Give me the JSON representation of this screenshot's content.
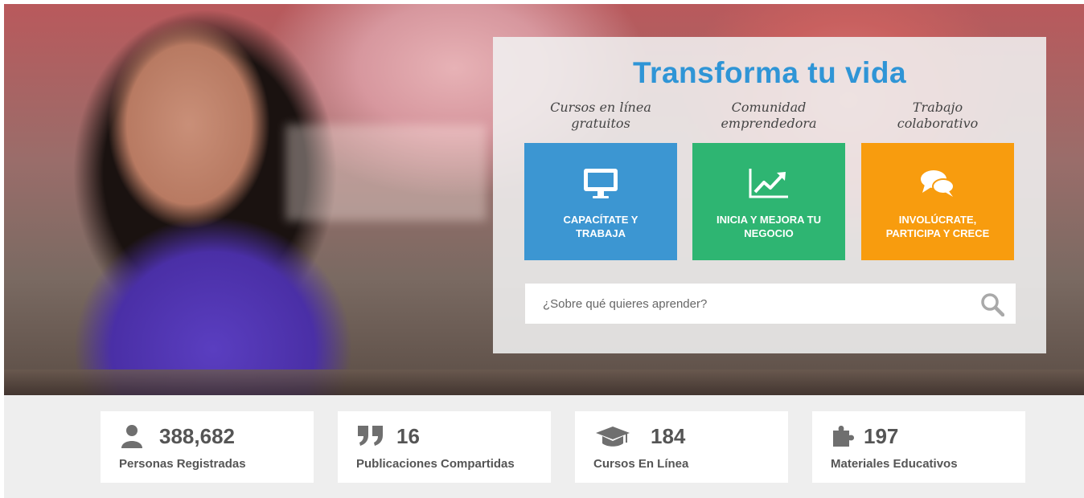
{
  "hero": {
    "title": "Transforma tu vida",
    "taglines": [
      {
        "line1": "Cursos en línea",
        "line2": "gratuitos"
      },
      {
        "line1": "Comunidad",
        "line2": "emprendedora"
      },
      {
        "line1": "Trabajo",
        "line2": "colaborativo"
      }
    ],
    "tiles": [
      {
        "line1": "CAPACÍTATE Y",
        "line2": "TRABAJA",
        "icon": "monitor-icon",
        "color": "#3c96d2"
      },
      {
        "line1": "INICIA Y MEJORA TU",
        "line2": "NEGOCIO",
        "icon": "chart-line-icon",
        "color": "#2eb572"
      },
      {
        "line1": "INVOLÚCRATE,",
        "line2": "PARTICIPA Y CRECE",
        "icon": "chat-bubbles-icon",
        "color": "#f89c0e"
      }
    ],
    "search": {
      "placeholder": "¿Sobre qué quieres aprender?",
      "icon": "search-icon"
    }
  },
  "stats": [
    {
      "value": "388,682",
      "label": "Personas Registradas",
      "icon": "user-icon"
    },
    {
      "value": "16",
      "label": "Publicaciones Compartidas",
      "icon": "quote-icon"
    },
    {
      "value": "184",
      "label": "Cursos En Línea",
      "icon": "graduation-cap-icon"
    },
    {
      "value": "197",
      "label": "Materiales Educativos",
      "icon": "puzzle-icon"
    }
  ],
  "colors": {
    "title": "#2f95d6",
    "stat_text": "#555555",
    "stats_band": "#eeeeee"
  }
}
